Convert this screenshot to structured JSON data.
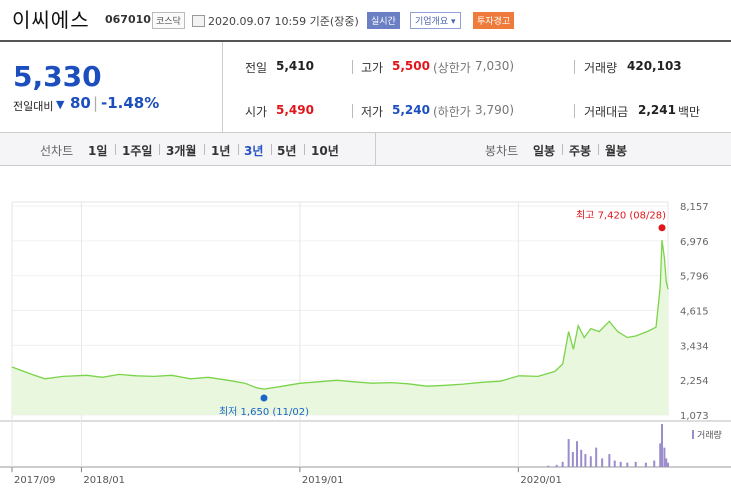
{
  "header": {
    "name": "이씨에스",
    "code": "067010",
    "market": "코스닥",
    "as_of": "2020.09.07 10:59 기준(장중)",
    "realtime_label": "실시간",
    "corp_info_label": "기업개요",
    "warning_label": "투자경고"
  },
  "summary": {
    "price": "5,330",
    "change_label": "전일대비",
    "change_arrow": "▼",
    "change_amount": "80",
    "change_pct": "-1.48%",
    "prev_label": "전일",
    "prev_value": "5,410",
    "high_label": "고가",
    "high_value": "5,500",
    "upper_limit_label": "(상한가",
    "upper_limit_value": "7,030)",
    "volume_label": "거래량",
    "volume_value": "420,103",
    "open_label": "시가",
    "open_value": "5,490",
    "low_label": "저가",
    "low_value": "5,240",
    "lower_limit_label": "(하한가",
    "lower_limit_value": "3,790)",
    "amount_label": "거래대금",
    "amount_value": "2,241",
    "amount_unit": "백만"
  },
  "toolbar": {
    "line_label": "선차트",
    "periods": [
      "1일",
      "1주일",
      "3개월",
      "1년",
      "3년",
      "5년",
      "10년"
    ],
    "selected_period": "3년",
    "candle_label": "봉차트",
    "candles": [
      "일봉",
      "주봉",
      "월봉"
    ]
  },
  "chart_data": {
    "type": "area",
    "y_ticks": [
      "8,157",
      "6,976",
      "5,796",
      "4,615",
      "3,434",
      "2,254",
      "1,073"
    ],
    "ylim": [
      1073,
      8157
    ],
    "x_ticks": [
      {
        "label": "2017/09",
        "date": "2017-09"
      },
      {
        "label": "2018/01",
        "date": "2018-01"
      },
      {
        "label": "2019/01",
        "date": "2019-01"
      },
      {
        "label": "2020/01",
        "date": "2020-01"
      }
    ],
    "x_range": [
      "2017-09-07",
      "2020-09-07"
    ],
    "max_annotation": "최고 7,420 (08/28)",
    "min_annotation": "최저 1,650 (11/02)",
    "max_point": {
      "date": "2020-08-28",
      "value": 7420
    },
    "min_point": {
      "date": "2018-11-02",
      "value": 1650
    },
    "volume_legend": "거래량",
    "series": [
      {
        "points": [
          [
            "2017-09-07",
            2700
          ],
          [
            "2017-10-10",
            2450
          ],
          [
            "2017-11-01",
            2300
          ],
          [
            "2017-12-01",
            2380
          ],
          [
            "2018-01-10",
            2420
          ],
          [
            "2018-02-05",
            2350
          ],
          [
            "2018-03-05",
            2450
          ],
          [
            "2018-04-02",
            2400
          ],
          [
            "2018-05-02",
            2380
          ],
          [
            "2018-06-01",
            2420
          ],
          [
            "2018-07-02",
            2300
          ],
          [
            "2018-08-01",
            2350
          ],
          [
            "2018-09-03",
            2250
          ],
          [
            "2018-10-01",
            2150
          ],
          [
            "2018-10-20",
            2000
          ],
          [
            "2018-11-02",
            1950
          ],
          [
            "2018-12-03",
            2050
          ],
          [
            "2019-01-02",
            2150
          ],
          [
            "2019-02-01",
            2200
          ],
          [
            "2019-03-04",
            2250
          ],
          [
            "2019-04-01",
            2200
          ],
          [
            "2019-05-02",
            2150
          ],
          [
            "2019-06-03",
            2170
          ],
          [
            "2019-07-01",
            2130
          ],
          [
            "2019-08-01",
            2050
          ],
          [
            "2019-09-02",
            2080
          ],
          [
            "2019-10-01",
            2120
          ],
          [
            "2019-11-01",
            2180
          ],
          [
            "2019-12-02",
            2220
          ],
          [
            "2020-01-02",
            2400
          ],
          [
            "2020-02-03",
            2380
          ],
          [
            "2020-03-02",
            2550
          ],
          [
            "2020-03-15",
            2800
          ],
          [
            "2020-03-25",
            3900
          ],
          [
            "2020-04-02",
            3300
          ],
          [
            "2020-04-10",
            4100
          ],
          [
            "2020-04-20",
            3700
          ],
          [
            "2020-05-01",
            4000
          ],
          [
            "2020-05-15",
            3900
          ],
          [
            "2020-06-01",
            4250
          ],
          [
            "2020-06-15",
            3900
          ],
          [
            "2020-07-01",
            3700
          ],
          [
            "2020-07-15",
            3750
          ],
          [
            "2020-08-03",
            3900
          ],
          [
            "2020-08-18",
            4050
          ],
          [
            "2020-08-25",
            5400
          ],
          [
            "2020-08-28",
            7000
          ],
          [
            "2020-09-01",
            6400
          ],
          [
            "2020-09-04",
            5600
          ],
          [
            "2020-09-07",
            5330
          ]
        ]
      }
    ],
    "volume": [
      [
        "2020-02-20",
        0.03
      ],
      [
        "2020-03-05",
        0.05
      ],
      [
        "2020-03-15",
        0.12
      ],
      [
        "2020-03-25",
        0.65
      ],
      [
        "2020-04-01",
        0.35
      ],
      [
        "2020-04-08",
        0.6
      ],
      [
        "2020-04-15",
        0.4
      ],
      [
        "2020-04-22",
        0.3
      ],
      [
        "2020-05-01",
        0.25
      ],
      [
        "2020-05-10",
        0.45
      ],
      [
        "2020-05-20",
        0.2
      ],
      [
        "2020-06-01",
        0.3
      ],
      [
        "2020-06-10",
        0.15
      ],
      [
        "2020-06-20",
        0.12
      ],
      [
        "2020-07-01",
        0.1
      ],
      [
        "2020-07-15",
        0.12
      ],
      [
        "2020-08-01",
        0.1
      ],
      [
        "2020-08-15",
        0.15
      ],
      [
        "2020-08-25",
        0.55
      ],
      [
        "2020-08-28",
        1.0
      ],
      [
        "2020-09-01",
        0.45
      ],
      [
        "2020-09-04",
        0.2
      ],
      [
        "2020-09-07",
        0.1
      ]
    ],
    "colors": {
      "line": "#7ad44a",
      "fill": "#e9f7df",
      "volume": "#9b8ccc",
      "max": "#e0161c",
      "min": "#1c64c8"
    }
  }
}
